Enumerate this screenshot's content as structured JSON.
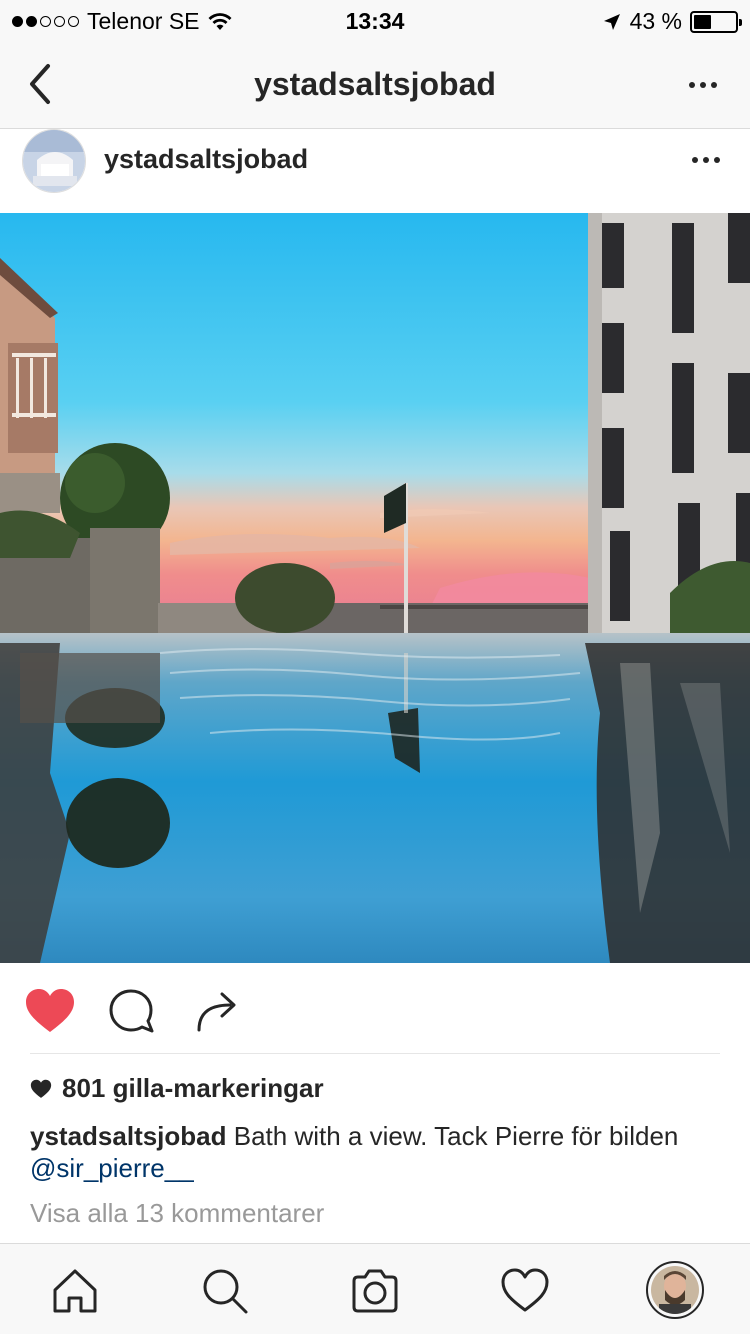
{
  "status_bar": {
    "carrier": "Telenor SE",
    "time": "13:34",
    "battery_percent": "43 %",
    "battery_level": 0.43,
    "signal_bars_filled": 2,
    "signal_bars_total": 5
  },
  "nav": {
    "title": "ystadsaltsjobad",
    "back_icon": "chevron-left-icon",
    "more_icon": "more-horizontal-icon"
  },
  "post": {
    "username": "ystadsaltsjobad",
    "likes": "801 gilla-markeringar",
    "caption_user": "ystadsaltsjobad",
    "caption_text": " Bath with a view. Tack Pierre för bilden ",
    "caption_mention": "@sir_pierre__",
    "view_comments": "Visa alla 13 kommentarer",
    "liked": true
  },
  "colors": {
    "heart": "#ed4956",
    "mention": "#003569",
    "muted": "#999999"
  },
  "tabs": [
    "home-icon",
    "search-icon",
    "camera-icon",
    "heart-icon",
    "profile-avatar"
  ]
}
